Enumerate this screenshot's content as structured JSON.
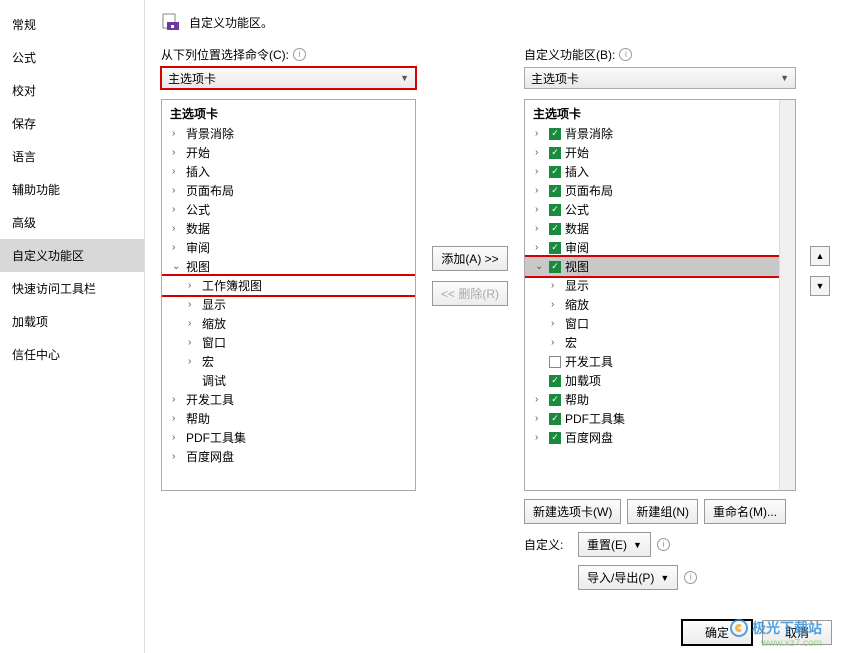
{
  "sidebar": {
    "items": [
      "常规",
      "公式",
      "校对",
      "保存",
      "语言",
      "辅助功能",
      "高级",
      "自定义功能区",
      "快速访问工具栏",
      "加载项",
      "信任中心"
    ],
    "active_index": 7
  },
  "header": {
    "title": "自定义功能区。"
  },
  "left_panel": {
    "label": "从下列位置选择命令(C):",
    "combo": "主选项卡",
    "tree_header": "主选项卡",
    "items": [
      {
        "level": 1,
        "toggle": ">",
        "label": "背景消除"
      },
      {
        "level": 1,
        "toggle": ">",
        "label": "开始"
      },
      {
        "level": 1,
        "toggle": ">",
        "label": "插入"
      },
      {
        "level": 1,
        "toggle": ">",
        "label": "页面布局"
      },
      {
        "level": 1,
        "toggle": ">",
        "label": "公式"
      },
      {
        "level": 1,
        "toggle": ">",
        "label": "数据"
      },
      {
        "level": 1,
        "toggle": ">",
        "label": "审阅"
      },
      {
        "level": 1,
        "toggle": "v",
        "label": "视图",
        "expanded": true
      },
      {
        "level": 2,
        "toggle": ">",
        "label": "工作簿视图",
        "highlight": true
      },
      {
        "level": 2,
        "toggle": ">",
        "label": "显示"
      },
      {
        "level": 2,
        "toggle": ">",
        "label": "缩放"
      },
      {
        "level": 2,
        "toggle": ">",
        "label": "窗口"
      },
      {
        "level": 2,
        "toggle": ">",
        "label": "宏"
      },
      {
        "level": 2,
        "toggle": "",
        "label": "调试"
      },
      {
        "level": 1,
        "toggle": ">",
        "label": "开发工具"
      },
      {
        "level": 1,
        "toggle": ">",
        "label": "帮助"
      },
      {
        "level": 1,
        "toggle": ">",
        "label": "PDF工具集"
      },
      {
        "level": 1,
        "toggle": ">",
        "label": "百度网盘"
      }
    ]
  },
  "middle": {
    "add": "添加(A) >>",
    "remove": "<<  删除(R)"
  },
  "right_panel": {
    "label": "自定义功能区(B):",
    "combo": "主选项卡",
    "tree_header": "主选项卡",
    "items": [
      {
        "level": 1,
        "toggle": ">",
        "checked": true,
        "label": "背景消除"
      },
      {
        "level": 1,
        "toggle": ">",
        "checked": true,
        "label": "开始"
      },
      {
        "level": 1,
        "toggle": ">",
        "checked": true,
        "label": "插入"
      },
      {
        "level": 1,
        "toggle": ">",
        "checked": true,
        "label": "页面布局"
      },
      {
        "level": 1,
        "toggle": ">",
        "checked": true,
        "label": "公式"
      },
      {
        "level": 1,
        "toggle": ">",
        "checked": true,
        "label": "数据"
      },
      {
        "level": 1,
        "toggle": ">",
        "checked": true,
        "label": "审阅"
      },
      {
        "level": 1,
        "toggle": "v",
        "checked": true,
        "label": "视图",
        "selected": true,
        "highlight": true
      },
      {
        "level": 2,
        "toggle": ">",
        "label": "显示"
      },
      {
        "level": 2,
        "toggle": ">",
        "label": "缩放"
      },
      {
        "level": 2,
        "toggle": ">",
        "label": "窗口"
      },
      {
        "level": 2,
        "toggle": ">",
        "label": "宏"
      },
      {
        "level": 1,
        "toggle": "",
        "checked": false,
        "label": "开发工具"
      },
      {
        "level": 1,
        "toggle": "",
        "checked": true,
        "label": "加载项"
      },
      {
        "level": 1,
        "toggle": ">",
        "checked": true,
        "label": "帮助"
      },
      {
        "level": 1,
        "toggle": ">",
        "checked": true,
        "label": "PDF工具集"
      },
      {
        "level": 1,
        "toggle": ">",
        "checked": true,
        "label": "百度网盘"
      }
    ],
    "buttons": {
      "new_tab": "新建选项卡(W)",
      "new_group": "新建组(N)",
      "rename": "重命名(M)..."
    },
    "custom_label": "自定义:",
    "reset": "重置(E)",
    "import_export": "导入/导出(P)"
  },
  "footer": {
    "ok": "确定",
    "cancel": "取消"
  },
  "watermark": {
    "text": "极光下载站",
    "url": "www.xz7.com"
  }
}
